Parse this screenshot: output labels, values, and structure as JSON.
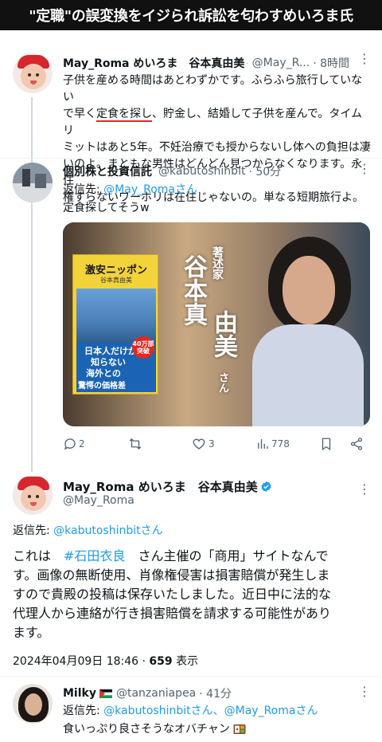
{
  "banner": {
    "title": "\"定職\"の誤変換をイジられ訴訟を匂わすめいろま氏"
  },
  "tweet1": {
    "display_name": "May_Roma めいろま　谷本真由美",
    "handle": "@May_R...",
    "time": "· 8時間",
    "lines": [
      [
        "子供を産める時間はあとわずかです。ふらふら旅行していない"
      ],
      [
        "で早く",
        "定食を探し",
        "、貯金し、結婚して子供を産んで。タイムリ"
      ],
      [
        "ミットはあと5年。不妊治療でも授からないし体への負担は凄"
      ],
      [
        "いのよ。まともな男性はどんどん見つからなくなります。永住"
      ],
      [
        "権すらないワーホリは在住じゃないの。単なる短期旅行よ。"
      ]
    ]
  },
  "tweet2": {
    "display_name": "個別株と投資信託",
    "handle": "@kabutoshinbit",
    "time": "· 50分",
    "reply_prefix": "返信先: ",
    "reply_to": "@May_Romaさん",
    "text": "定食探してそうw",
    "media": {
      "book_title": "激安ニッポン",
      "book_author": "谷本真由美",
      "book_lines": [
        "日本人だけが",
        "知らない",
        "海外との",
        "驚愕の価格差"
      ],
      "book_badge": "40万部突破",
      "caption_role": "著述家",
      "caption_name1": "谷本真",
      "caption_name2": "由美",
      "caption_honorific": "さん"
    },
    "actions": {
      "replies": "2",
      "retweets": "",
      "likes": "3",
      "views": "778"
    }
  },
  "tweet3": {
    "display_name": "May_Roma めいろま　谷本真由美",
    "handle": "@May_Roma",
    "reply_prefix": "返信先: ",
    "reply_to": "@kabutoshinbitさん",
    "lines": [
      [
        "これは　",
        "#石田衣良",
        "　さん主催の「商用」サイトなんで"
      ],
      [
        "す。画像の無断使用、肖像権侵害は損害賠償が発生しま"
      ],
      [
        "すので貴殿の投稿は保存いたしました。近日中に法的な"
      ],
      [
        "代理人から連絡が行き損害賠償を請求する可能性があり"
      ],
      [
        "ます。"
      ]
    ],
    "timestamp": "2024年04月09日 18:46 · ",
    "views_count": "659",
    "views_label": " 表示"
  },
  "tweet4": {
    "display_name": "Milky",
    "flag_icon": "palestine-flag-icon",
    "handle": "@tanzaniapea",
    "time": "· 41分",
    "reply_prefix": "返信先: ",
    "reply_to": "@kabutoshinbitさん、@May_Romaさん",
    "text": "食いっぷり良さそうなオバチャン",
    "emoji_icon": "bento-box-icon"
  },
  "colors": {
    "link": "#1d9bf0",
    "gray": "#536471",
    "verified": "#1d9bf0",
    "underline": "#e0262e"
  }
}
